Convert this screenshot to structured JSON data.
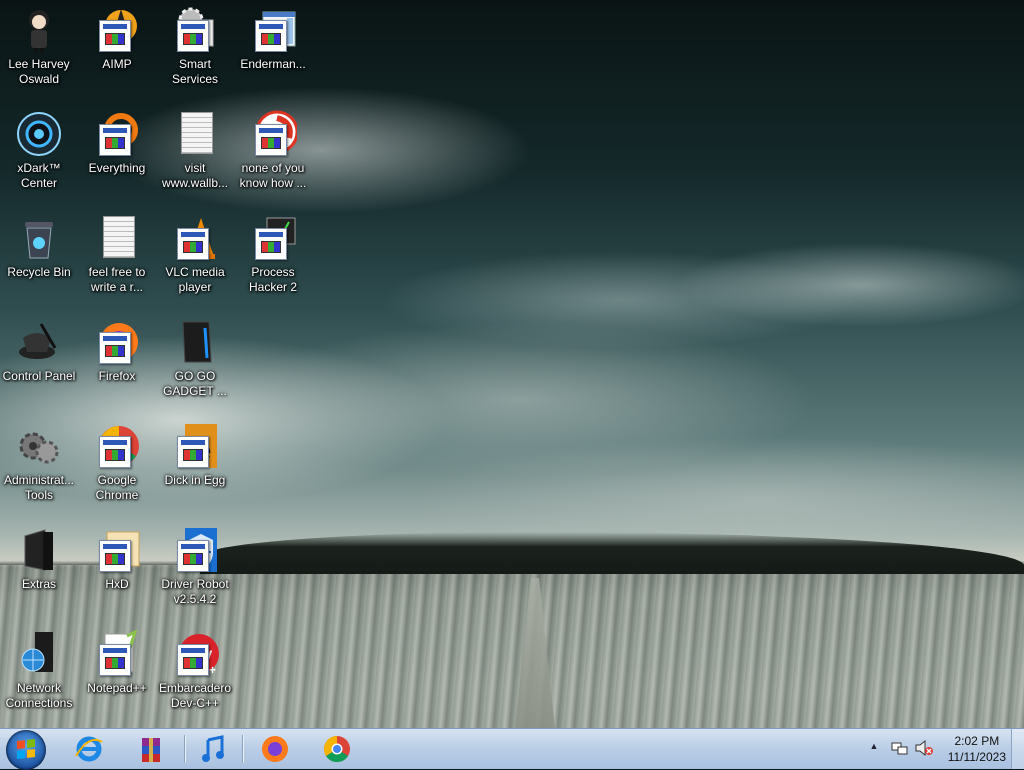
{
  "desktop": {
    "icons": [
      {
        "label": "Lee Harvey\nOswald",
        "icon": "character-icon"
      },
      {
        "label": "AIMP",
        "icon": "aimp-icon"
      },
      {
        "label": "Smart\nServices",
        "icon": "gears-icon"
      },
      {
        "label": "Enderman...",
        "icon": "window-icon"
      },
      {
        "label": "xDark™\nCenter",
        "icon": "orb-icon"
      },
      {
        "label": "Everything",
        "icon": "search-ring-icon"
      },
      {
        "label": "visit\nwww.wallb...",
        "icon": "text-document-icon"
      },
      {
        "label": "none of you\nknow how ...",
        "icon": "red-swirl-icon"
      },
      {
        "label": "Recycle Bin",
        "icon": "recycle-bin-icon"
      },
      {
        "label": "feel free to\nwrite a r...",
        "icon": "text-document-icon"
      },
      {
        "label": "VLC media\nplayer",
        "icon": "vlc-cone-icon"
      },
      {
        "label": "Process\nHacker 2",
        "icon": "monitor-chart-icon"
      },
      {
        "label": "Control Panel",
        "icon": "control-panel-icon"
      },
      {
        "label": "Firefox",
        "icon": "firefox-icon"
      },
      {
        "label": "GO GO\nGADGET ...",
        "icon": "black-device-icon"
      },
      {
        "label": "Administrat...\nTools",
        "icon": "admin-tools-icon"
      },
      {
        "label": "Google\nChrome",
        "icon": "chrome-icon"
      },
      {
        "label": "Dick in Egg",
        "icon": "e-letter-icon"
      },
      {
        "label": "Extras",
        "icon": "black-folder-icon"
      },
      {
        "label": "HxD",
        "icon": "hxd-icon"
      },
      {
        "label": "Driver Robot\nv2.5.4.2",
        "icon": "shield-icon"
      },
      {
        "label": "Network\nConnections",
        "icon": "network-globe-icon"
      },
      {
        "label": "Notepad++",
        "icon": "notepad-icon"
      },
      {
        "label": "Embarcadero\nDev-C++",
        "icon": "devcpp-icon"
      }
    ]
  },
  "taskbar": {
    "pinned": [
      "internet-explorer-icon",
      "winrar-icon",
      "music-icon",
      "firefox-icon",
      "chrome-icon"
    ],
    "tray_icons": [
      "show-hidden-icons",
      "network-icon",
      "volume-muted-icon"
    ],
    "time": "2:02 PM",
    "date": "11/11/2023"
  }
}
